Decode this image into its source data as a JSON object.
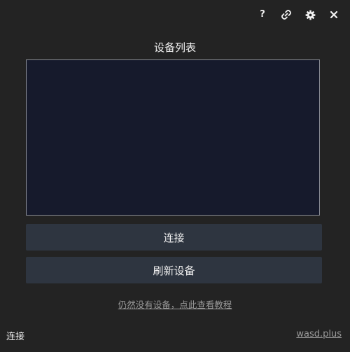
{
  "titlebar": {
    "help_label": "?",
    "icons": [
      "help-icon",
      "link-icon",
      "gear-icon",
      "close-icon"
    ]
  },
  "main": {
    "section_title": "设备列表",
    "device_list": [],
    "connect_label": "连接",
    "refresh_label": "刷新设备",
    "help_link": "仍然没有设备，点此查看教程"
  },
  "footer": {
    "status": "连接",
    "site": "wasd.plus"
  },
  "colors": {
    "background": "#232323",
    "list_background": "#161a2c",
    "button_background": "#2e3540"
  }
}
